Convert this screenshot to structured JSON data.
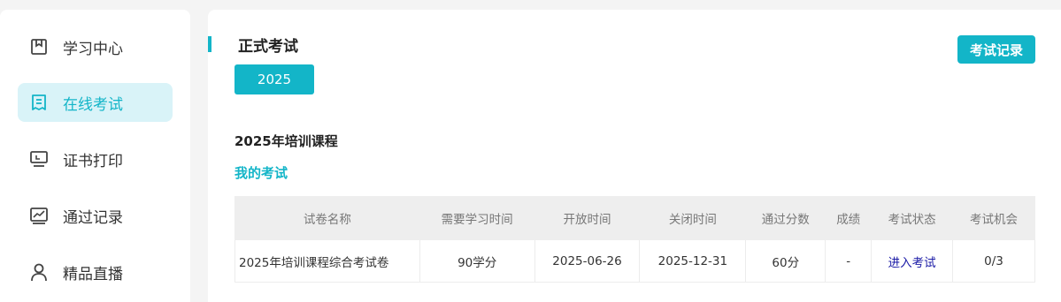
{
  "sidebar": {
    "items": [
      {
        "label": "学习中心",
        "icon": "bookmark-icon",
        "active": false
      },
      {
        "label": "在线考试",
        "icon": "document-icon",
        "active": true
      },
      {
        "label": "证书打印",
        "icon": "monitor-icon",
        "active": false
      },
      {
        "label": "通过记录",
        "icon": "chart-icon",
        "active": false
      },
      {
        "label": "精品直播",
        "icon": "user-icon",
        "active": false
      }
    ]
  },
  "main": {
    "title": "正式考试",
    "record_button": "考试记录",
    "year_button": "2025",
    "course_title": "2025年培训课程",
    "section_title": "我的考试",
    "table": {
      "headers": [
        "试卷名称",
        "需要学习时间",
        "开放时间",
        "关闭时间",
        "通过分数",
        "成绩",
        "考试状态",
        "考试机会"
      ],
      "rows": [
        [
          "2025年培训课程综合考试卷",
          "90学分",
          "2025-06-26",
          "2025-12-31",
          "60分",
          "-",
          "进入考试",
          "0/3"
        ]
      ]
    }
  },
  "colors": {
    "accent": "#13b5c8",
    "active_bg": "#d9f3f8",
    "link": "#1a1aa6"
  }
}
